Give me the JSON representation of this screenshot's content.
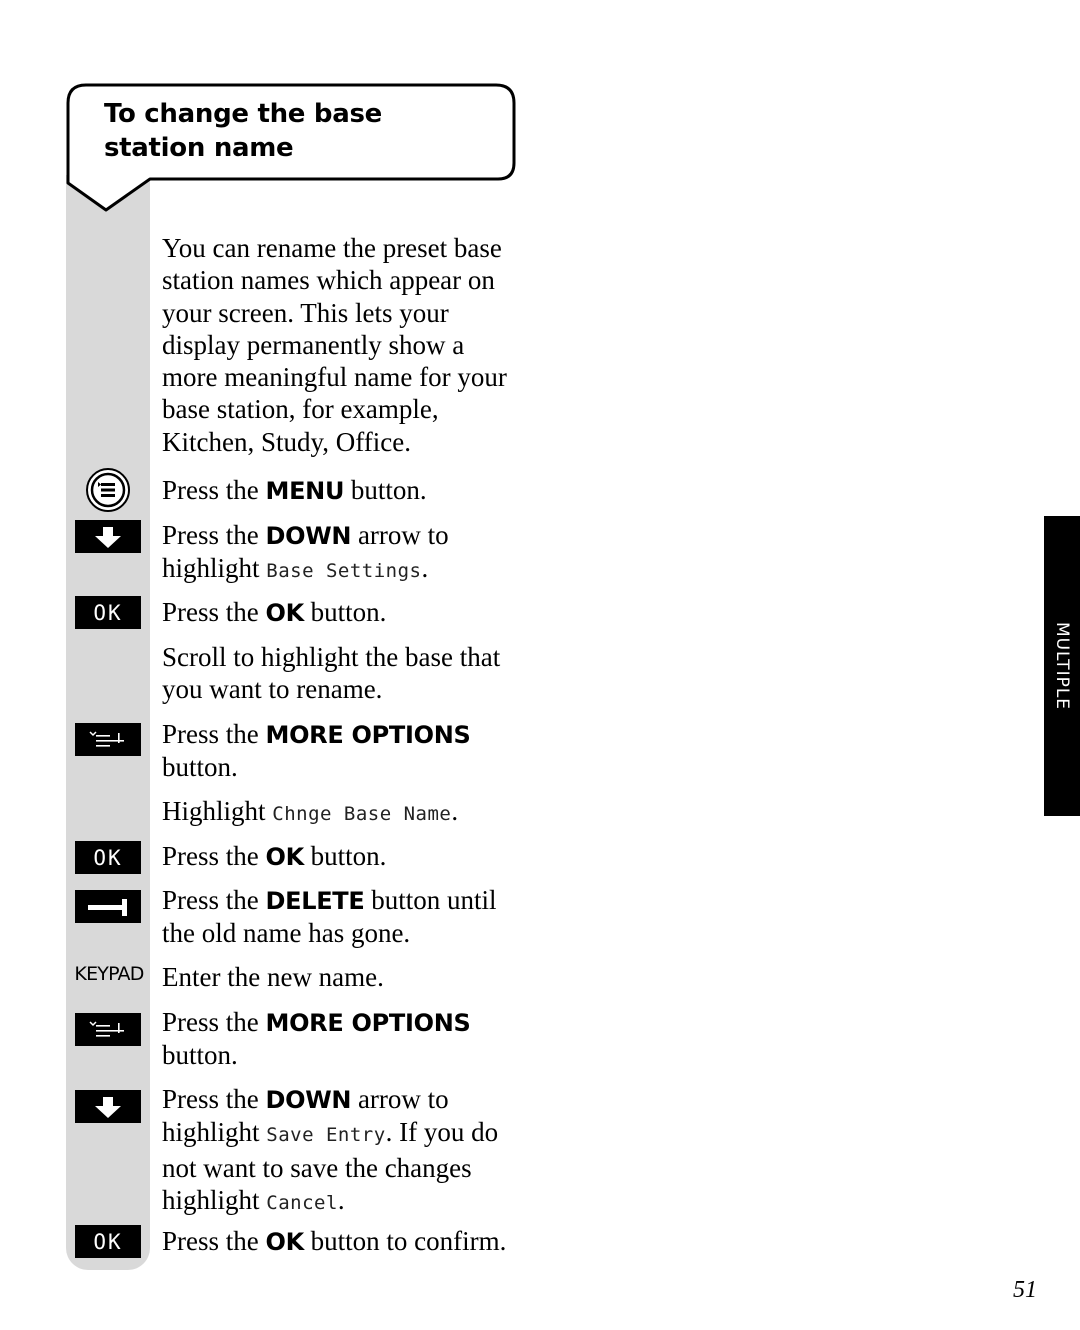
{
  "heading": {
    "line1": "To change the base",
    "line2": "station name"
  },
  "intro": "You can rename the preset base station names which appear on your screen. This lets your display permanently show a more meaningful name for your base station, for example, Kitchen, Study, Office.",
  "icons": {
    "ok_label": "OK",
    "keypad_label": "KEYPAD"
  },
  "steps": [
    {
      "icon": "menu-icon",
      "pre": "Press the ",
      "bold": "MENU",
      "post": " button.",
      "lcd": "",
      "tail": ""
    },
    {
      "icon": "down-arrow-icon",
      "pre": "Press the ",
      "bold": "DOWN",
      "post": " arrow to highlight ",
      "lcd": "Base Settings",
      "tail": "."
    },
    {
      "icon": "ok-icon",
      "pre": "Press the ",
      "bold": "OK",
      "post": " button.",
      "lcd": "",
      "tail": ""
    },
    {
      "icon": "",
      "pre": "Scroll to highlight the base that you want to rename.",
      "bold": "",
      "post": "",
      "lcd": "",
      "tail": ""
    },
    {
      "icon": "more-options-icon",
      "pre": "Press the ",
      "bold": "MORE OPTIONS",
      "post": " button.",
      "lcd": "",
      "tail": ""
    },
    {
      "icon": "",
      "pre": "Highlight ",
      "bold": "",
      "post": "",
      "lcd": "Chnge Base Name",
      "tail": "."
    },
    {
      "icon": "ok-icon",
      "pre": "Press the ",
      "bold": "OK",
      "post": " button.",
      "lcd": "",
      "tail": ""
    },
    {
      "icon": "delete-icon",
      "pre": "Press the ",
      "bold": "DELETE",
      "post": " button until the old name has gone.",
      "lcd": "",
      "tail": ""
    },
    {
      "icon": "keypad",
      "pre": "Enter the new name.",
      "bold": "",
      "post": "",
      "lcd": "",
      "tail": ""
    },
    {
      "icon": "more-options-icon",
      "pre": "Press the ",
      "bold": "MORE OPTIONS",
      "post": " button.",
      "lcd": "",
      "tail": ""
    },
    {
      "icon": "down-arrow-icon",
      "pre": "Press the ",
      "bold": "DOWN",
      "post": " arrow to highlight ",
      "lcd": "Save Entry",
      "tail": ". If you do not want to save the changes highlight ",
      "lcd2": "Cancel",
      "tail2": "."
    },
    {
      "icon": "ok-icon",
      "pre": "Press the ",
      "bold": "OK",
      "post": " button to confirm.",
      "lcd": "",
      "tail": ""
    }
  ],
  "side_tab": "MULTIPLE",
  "page_number": "51"
}
